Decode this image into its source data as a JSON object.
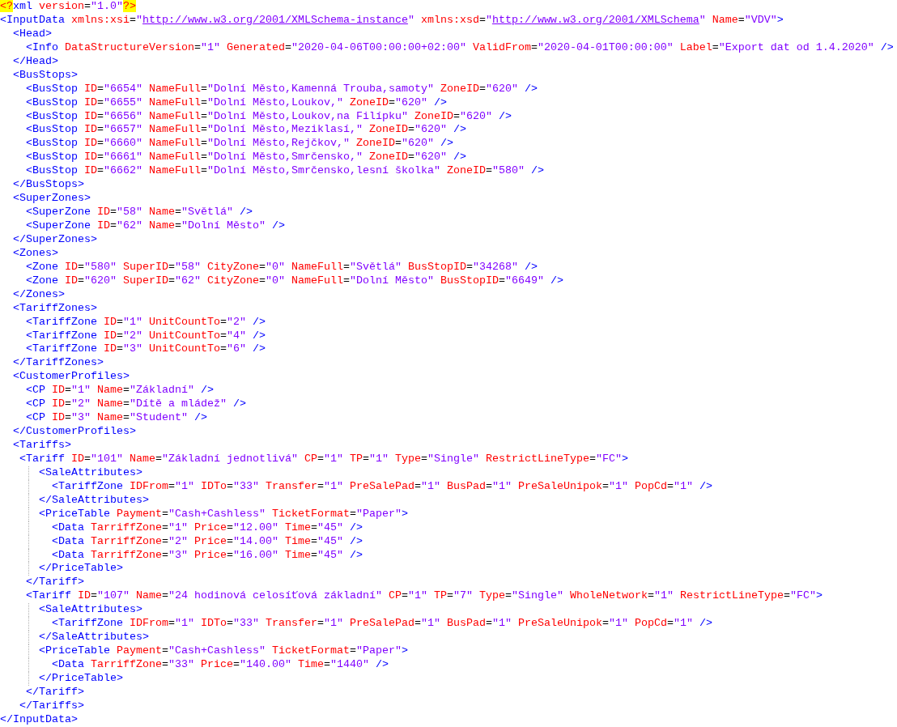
{
  "editor": {
    "lines": [
      {
        "text": "<?xml version=\"1.0\"?>"
      },
      {
        "text": "<InputData xmlns:xsi=\"http://www.w3.org/2001/XMLSchema-instance\" xmlns:xsd=\"http://www.w3.org/2001/XMLSchema\" Name=\"VDV\">"
      },
      {
        "text": "  <Head>"
      },
      {
        "text": "    <Info DataStructureVersion=\"1\" Generated=\"2020-04-06T00:00:00+02:00\" ValidFrom=\"2020-04-01T00:00:00\" Label=\"Export dat od 1.4.2020\" />"
      },
      {
        "text": "  </Head>"
      },
      {
        "text": "  <BusStops>"
      },
      {
        "text": "    <BusStop ID=\"6654\" NameFull=\"Dolní Město,Kamenná Trouba,samoty\" ZoneID=\"620\" />"
      },
      {
        "text": "    <BusStop ID=\"6655\" NameFull=\"Dolní Město,Loukov,\" ZoneID=\"620\" />"
      },
      {
        "text": "    <BusStop ID=\"6656\" NameFull=\"Dolní Město,Loukov,na Filípku\" ZoneID=\"620\" />"
      },
      {
        "text": "    <BusStop ID=\"6657\" NameFull=\"Dolní Město,Meziklasí,\" ZoneID=\"620\" />"
      },
      {
        "text": "    <BusStop ID=\"6660\" NameFull=\"Dolní Město,Rejčkov,\" ZoneID=\"620\" />"
      },
      {
        "text": "    <BusStop ID=\"6661\" NameFull=\"Dolní Město,Smrčensko,\" ZoneID=\"620\" />"
      },
      {
        "text": "    <BusStop ID=\"6662\" NameFull=\"Dolní Město,Smrčensko,lesní školka\" ZoneID=\"580\" />"
      },
      {
        "text": "  </BusStops>"
      },
      {
        "text": "  <SuperZones>"
      },
      {
        "text": "    <SuperZone ID=\"58\" Name=\"Světlá\" />"
      },
      {
        "text": "    <SuperZone ID=\"62\" Name=\"Dolní Město\" />"
      },
      {
        "text": "  </SuperZones>"
      },
      {
        "text": "  <Zones>"
      },
      {
        "text": "    <Zone ID=\"580\" SuperID=\"58\" CityZone=\"0\" NameFull=\"Světlá\" BusStopID=\"34268\" />"
      },
      {
        "text": "    <Zone ID=\"620\" SuperID=\"62\" CityZone=\"0\" NameFull=\"Dolní Město\" BusStopID=\"6649\" />"
      },
      {
        "text": "  </Zones>"
      },
      {
        "text": "  <TariffZones>"
      },
      {
        "text": "    <TariffZone ID=\"1\" UnitCountTo=\"2\" />"
      },
      {
        "text": "    <TariffZone ID=\"2\" UnitCountTo=\"4\" />"
      },
      {
        "text": "    <TariffZone ID=\"3\" UnitCountTo=\"6\" />"
      },
      {
        "text": "  </TariffZones>"
      },
      {
        "text": "  <CustomerProfiles>"
      },
      {
        "text": "    <CP ID=\"1\" Name=\"Základní\" />"
      },
      {
        "text": "    <CP ID=\"2\" Name=\"Dítě a mládež\" />"
      },
      {
        "text": "    <CP ID=\"3\" Name=\"Student\" />"
      },
      {
        "text": "  </CustomerProfiles>"
      },
      {
        "text": "  <Tariffs>"
      },
      {
        "text": "   <Tariff ID=\"101\" Name=\"Základní jednotlivá\" CP=\"1\" TP=\"1\" Type=\"Single\" RestrictLineType=\"FC\">"
      },
      {
        "text": "      <SaleAttributes>",
        "indent_guide": true
      },
      {
        "text": "        <TariffZone IDFrom=\"1\" IDTo=\"33\" Transfer=\"1\" PreSalePad=\"1\" BusPad=\"1\" PreSaleUnipok=\"1\" PopCd=\"1\" />",
        "indent_guide": true
      },
      {
        "text": "      </SaleAttributes>",
        "indent_guide": true
      },
      {
        "text": "      <PriceTable Payment=\"Cash+Cashless\" TicketFormat=\"Paper\">",
        "indent_guide": true
      },
      {
        "text": "        <Data TarriffZone=\"1\" Price=\"12.00\" Time=\"45\" />",
        "indent_guide": true
      },
      {
        "text": "        <Data TarriffZone=\"2\" Price=\"14.00\" Time=\"45\" />",
        "indent_guide": true
      },
      {
        "text": "        <Data TarriffZone=\"3\" Price=\"16.00\" Time=\"45\" />",
        "indent_guide": true
      },
      {
        "text": "      </PriceTable>",
        "indent_guide": true
      },
      {
        "text": "    </Tariff>"
      },
      {
        "text": "    <Tariff ID=\"107\" Name=\"24 hodinová celosíťová základní\" CP=\"1\" TP=\"7\" Type=\"Single\" WholeNetwork=\"1\" RestrictLineType=\"FC\">"
      },
      {
        "text": "      <SaleAttributes>",
        "indent_guide": true
      },
      {
        "text": "        <TariffZone IDFrom=\"1\" IDTo=\"33\" Transfer=\"1\" PreSalePad=\"1\" BusPad=\"1\" PreSaleUnipok=\"1\" PopCd=\"1\" />",
        "indent_guide": true
      },
      {
        "text": "      </SaleAttributes>",
        "indent_guide": true
      },
      {
        "text": "      <PriceTable Payment=\"Cash+Cashless\" TicketFormat=\"Paper\">",
        "indent_guide": true
      },
      {
        "text": "        <Data TarriffZone=\"33\" Price=\"140.00\" Time=\"1440\" />",
        "indent_guide": true
      },
      {
        "text": "      </PriceTable>",
        "indent_guide": true
      },
      {
        "text": "    </Tariff>"
      },
      {
        "text": "   </Tariffs>"
      },
      {
        "text": "</InputData>"
      }
    ]
  }
}
